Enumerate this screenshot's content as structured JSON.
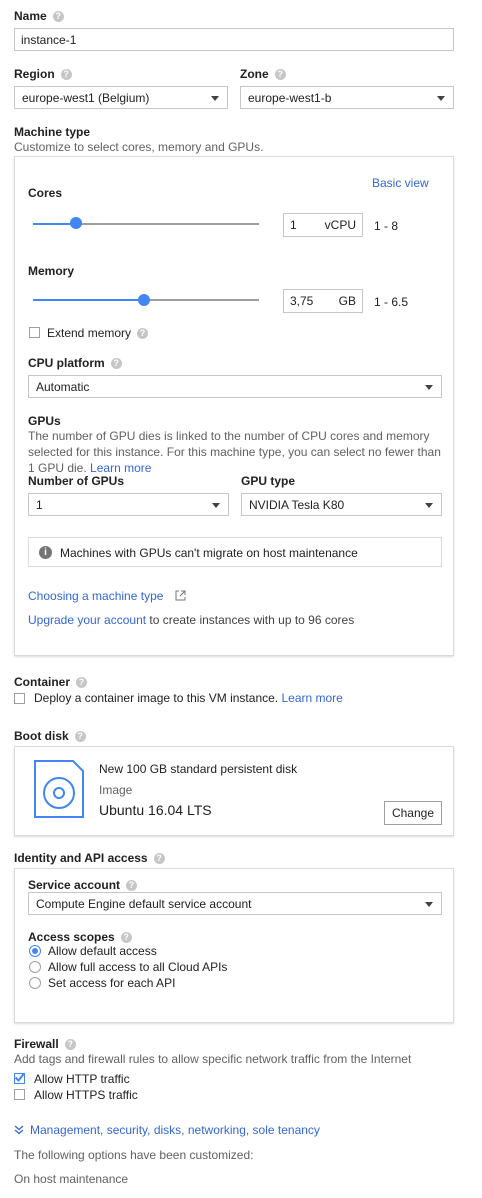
{
  "name": {
    "label": "Name",
    "value": "instance-1"
  },
  "region": {
    "label": "Region",
    "value": "europe-west1 (Belgium)"
  },
  "zone": {
    "label": "Zone",
    "value": "europe-west1-b"
  },
  "machine_type": {
    "label": "Machine type",
    "description": "Customize to select cores, memory and GPUs.",
    "basic_view": "Basic view",
    "cores": {
      "label": "Cores",
      "value": "1",
      "unit": "vCPU",
      "range": "1 - 8",
      "level": 0.2
    },
    "memory": {
      "label": "Memory",
      "value": "3,75",
      "unit": "GB",
      "range": "1 - 6.5",
      "level": 0.5
    },
    "extend_memory": "Extend memory",
    "cpu_platform": {
      "label": "CPU platform",
      "value": "Automatic"
    },
    "gpus": {
      "label": "GPUs",
      "description": "The number of GPU dies is linked to the number of CPU cores and memory selected for this instance. For this machine type, you can select no fewer than 1 GPU die.",
      "learn_more": "Learn more",
      "number_label": "Number of GPUs",
      "number_value": "1",
      "type_label": "GPU type",
      "type_value": "NVIDIA Tesla K80",
      "notice": "Machines with GPUs can't migrate on host maintenance"
    },
    "choosing_link": "Choosing a machine type",
    "upgrade_link": "Upgrade your account",
    "upgrade_text": " to create instances with up to 96 cores"
  },
  "container": {
    "label": "Container",
    "checkbox_text": "Deploy a container image to this VM instance.",
    "learn_more": "Learn more"
  },
  "boot_disk": {
    "label": "Boot disk",
    "title": "New 100 GB standard persistent disk",
    "image_label": "Image",
    "image_value": "Ubuntu 16.04 LTS",
    "change": "Change"
  },
  "identity": {
    "label": "Identity and API access",
    "service_account_label": "Service account",
    "service_account_value": "Compute Engine default service account",
    "access_scopes_label": "Access scopes",
    "scopes": [
      "Allow default access",
      "Allow full access to all Cloud APIs",
      "Set access for each API"
    ]
  },
  "firewall": {
    "label": "Firewall",
    "description": "Add tags and firewall rules to allow specific network traffic from the Internet",
    "http": "Allow HTTP traffic",
    "https": "Allow HTTPS traffic"
  },
  "management_link": "Management, security, disks, networking, sole tenancy",
  "customized_text": "The following options have been customized:",
  "host_maintenance": "On host maintenance",
  "colors": {
    "accent": "#4285f4",
    "link": "#3367d6",
    "help": "#c6c6c6"
  }
}
